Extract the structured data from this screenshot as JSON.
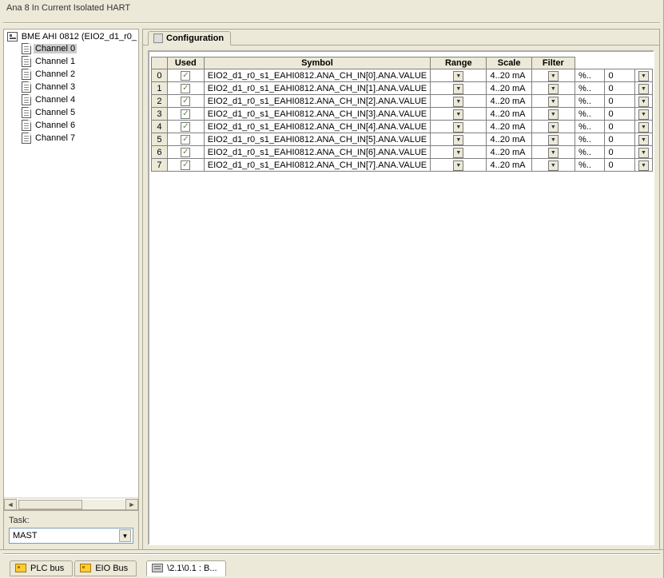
{
  "window": {
    "title": "Ana 8 In Current Isolated HART"
  },
  "tree": {
    "root": "BME AHI 0812 (EIO2_d1_r0_",
    "channels": [
      {
        "label": "Channel 0",
        "selected": true
      },
      {
        "label": "Channel 1",
        "selected": false
      },
      {
        "label": "Channel 2",
        "selected": false
      },
      {
        "label": "Channel 3",
        "selected": false
      },
      {
        "label": "Channel 4",
        "selected": false
      },
      {
        "label": "Channel 5",
        "selected": false
      },
      {
        "label": "Channel 6",
        "selected": false
      },
      {
        "label": "Channel 7",
        "selected": false
      }
    ]
  },
  "task": {
    "label": "Task:",
    "value": "MAST"
  },
  "tab": {
    "label": "Configuration"
  },
  "table": {
    "headers": {
      "used": "Used",
      "symbol": "Symbol",
      "range": "Range",
      "scale": "Scale",
      "filter": "Filter"
    },
    "rows": [
      {
        "idx": "0",
        "symbol": "EIO2_d1_r0_s1_EAHI0812.ANA_CH_IN[0].ANA.VALUE",
        "range": "4..20 mA",
        "scale": "%..",
        "filter": "0"
      },
      {
        "idx": "1",
        "symbol": "EIO2_d1_r0_s1_EAHI0812.ANA_CH_IN[1].ANA.VALUE",
        "range": "4..20 mA",
        "scale": "%..",
        "filter": "0"
      },
      {
        "idx": "2",
        "symbol": "EIO2_d1_r0_s1_EAHI0812.ANA_CH_IN[2].ANA.VALUE",
        "range": "4..20 mA",
        "scale": "%..",
        "filter": "0"
      },
      {
        "idx": "3",
        "symbol": "EIO2_d1_r0_s1_EAHI0812.ANA_CH_IN[3].ANA.VALUE",
        "range": "4..20 mA",
        "scale": "%..",
        "filter": "0"
      },
      {
        "idx": "4",
        "symbol": "EIO2_d1_r0_s1_EAHI0812.ANA_CH_IN[4].ANA.VALUE",
        "range": "4..20 mA",
        "scale": "%..",
        "filter": "0"
      },
      {
        "idx": "5",
        "symbol": "EIO2_d1_r0_s1_EAHI0812.ANA_CH_IN[5].ANA.VALUE",
        "range": "4..20 mA",
        "scale": "%..",
        "filter": "0"
      },
      {
        "idx": "6",
        "symbol": "EIO2_d1_r0_s1_EAHI0812.ANA_CH_IN[6].ANA.VALUE",
        "range": "4..20 mA",
        "scale": "%..",
        "filter": "0"
      },
      {
        "idx": "7",
        "symbol": "EIO2_d1_r0_s1_EAHI0812.ANA_CH_IN[7].ANA.VALUE",
        "range": "4..20 mA",
        "scale": "%..",
        "filter": "0"
      }
    ]
  },
  "bottomTabs": {
    "plc": "PLC bus",
    "eio": "EIO Bus",
    "path": "\\2.1\\0.1 : B..."
  }
}
